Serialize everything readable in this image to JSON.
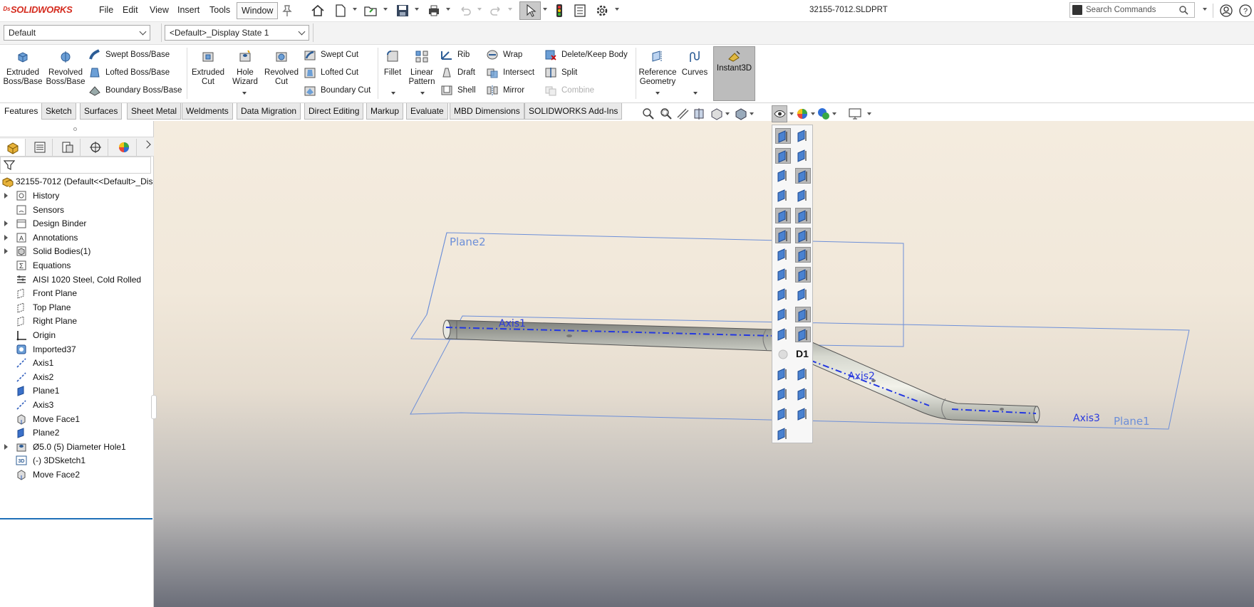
{
  "app": {
    "name": "SOLIDWORKS",
    "document_title": "32155-7012.SLDPRT"
  },
  "menu": {
    "file": "File",
    "edit": "Edit",
    "view": "View",
    "insert": "Insert",
    "tools": "Tools",
    "window": "Window"
  },
  "search": {
    "placeholder": "Search Commands"
  },
  "config": {
    "configuration": "Default",
    "display_state": "<Default>_Display State 1"
  },
  "commands": {
    "extruded_boss": "Extruded Boss/Base",
    "revolved_boss": "Revolved Boss/Base",
    "swept_boss": "Swept Boss/Base",
    "lofted_boss": "Lofted Boss/Base",
    "boundary_boss": "Boundary Boss/Base",
    "extruded_cut": "Extruded Cut",
    "hole_wizard": "Hole Wizard",
    "revolved_cut": "Revolved Cut",
    "swept_cut": "Swept Cut",
    "lofted_cut": "Lofted Cut",
    "boundary_cut": "Boundary Cut",
    "fillet": "Fillet",
    "linear_pattern": "Linear Pattern",
    "rib": "Rib",
    "draft": "Draft",
    "shell": "Shell",
    "wrap": "Wrap",
    "intersect": "Intersect",
    "mirror": "Mirror",
    "delete_keep_body": "Delete/Keep Body",
    "split": "Split",
    "combine": "Combine",
    "reference_geometry": "Reference Geometry",
    "curves": "Curves",
    "instant3d": "Instant3D"
  },
  "tabs": [
    "Features",
    "Sketch",
    "Surfaces",
    "Sheet Metal",
    "Weldments",
    "Data Migration",
    "Direct Editing",
    "Markup",
    "Evaluate",
    "MBD Dimensions",
    "SOLIDWORKS Add-Ins"
  ],
  "tree": {
    "root": "32155-7012  (Default<<Default>_Dis",
    "items": [
      {
        "label": "History",
        "icon": "history-icon",
        "expandable": true
      },
      {
        "label": "Sensors",
        "icon": "sensors-icon",
        "expandable": false
      },
      {
        "label": "Design Binder",
        "icon": "design-binder-icon",
        "expandable": true
      },
      {
        "label": "Annotations",
        "icon": "annotations-icon",
        "expandable": true
      },
      {
        "label": "Solid Bodies(1)",
        "icon": "solid-bodies-icon",
        "expandable": true
      },
      {
        "label": "Equations",
        "icon": "equations-icon",
        "expandable": false
      },
      {
        "label": "AISI 1020 Steel, Cold Rolled",
        "icon": "material-icon",
        "expandable": false
      },
      {
        "label": "Front Plane",
        "icon": "plane-icon",
        "expandable": false
      },
      {
        "label": "Top Plane",
        "icon": "plane-icon",
        "expandable": false
      },
      {
        "label": "Right Plane",
        "icon": "plane-icon",
        "expandable": false
      },
      {
        "label": "Origin",
        "icon": "origin-icon",
        "expandable": false
      },
      {
        "label": "Imported37",
        "icon": "imported-body-icon",
        "expandable": false
      },
      {
        "label": "Axis1",
        "icon": "axis-icon",
        "expandable": false
      },
      {
        "label": "Axis2",
        "icon": "axis-icon",
        "expandable": false
      },
      {
        "label": "Plane1",
        "icon": "plane-filled-icon",
        "expandable": false
      },
      {
        "label": "Axis3",
        "icon": "axis-icon",
        "expandable": false
      },
      {
        "label": "Move Face1",
        "icon": "move-face-icon",
        "expandable": false
      },
      {
        "label": "Plane2",
        "icon": "plane-filled-icon",
        "expandable": false
      },
      {
        "label": "Ø5.0 (5) Diameter Hole1",
        "icon": "hole-icon",
        "expandable": true
      },
      {
        "label": "(-) 3DSketch1",
        "icon": "3dsketch-icon",
        "expandable": false
      },
      {
        "label": "Move Face2",
        "icon": "move-face-icon",
        "expandable": false
      }
    ]
  },
  "viewport": {
    "labels": {
      "plane2": "Plane2",
      "plane1": "Plane1",
      "axis1": "Axis1",
      "axis2": "Axis2",
      "axis3": "Axis3"
    },
    "palette_text": "D1"
  },
  "colors": {
    "brand": "#d52b1e",
    "selection_blue": "#1f6fb8",
    "reference_geometry": "#4a6fd6"
  }
}
